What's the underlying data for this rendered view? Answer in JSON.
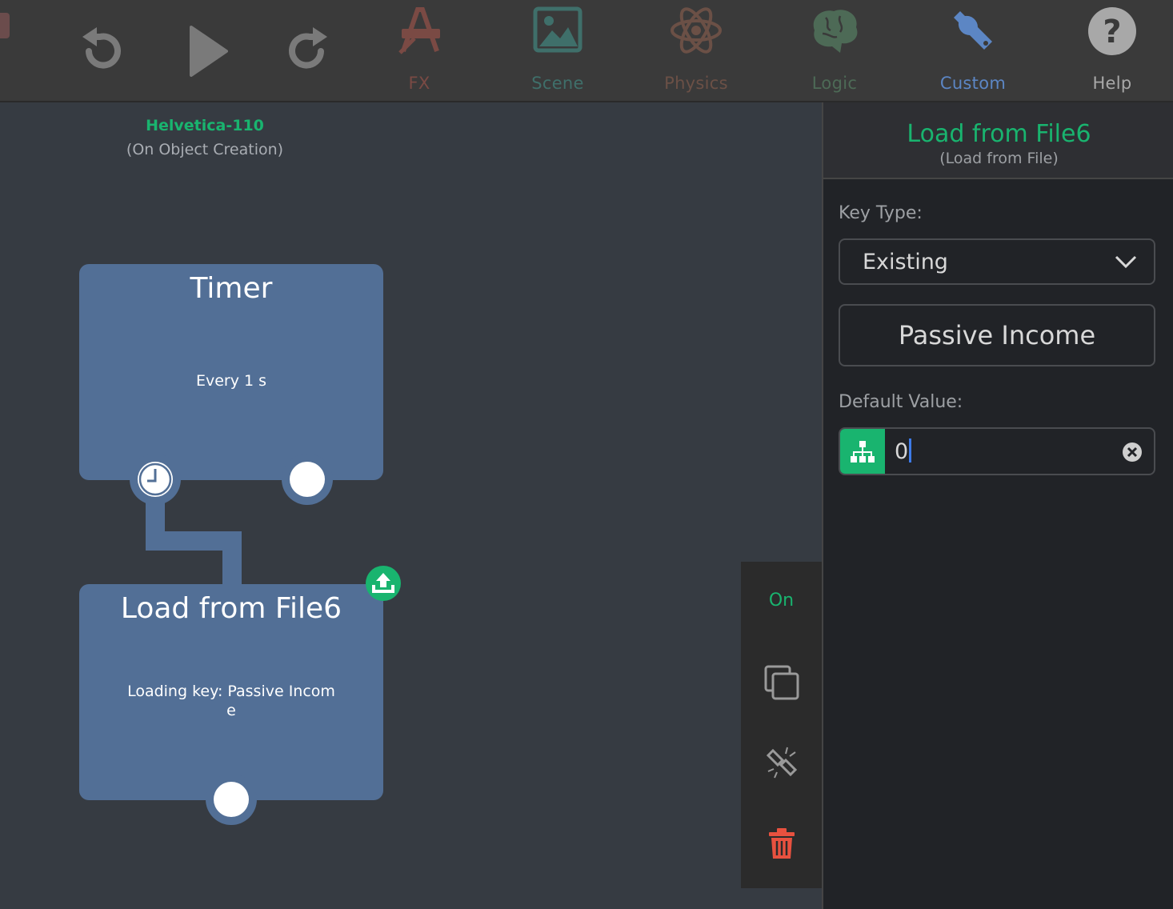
{
  "toolbar": {
    "undo_icon": "undo-icon",
    "play_icon": "play-icon",
    "redo_icon": "redo-icon",
    "tabs": [
      {
        "label": "FX",
        "icon": "fx-icon",
        "color": "#7a4a44"
      },
      {
        "label": "Scene",
        "icon": "scene-icon",
        "color": "#3f6f6a"
      },
      {
        "label": "Physics",
        "icon": "physics-icon",
        "color": "#6b5046"
      },
      {
        "label": "Logic",
        "icon": "brain-icon",
        "color": "#4d6a56"
      },
      {
        "label": "Custom",
        "icon": "wrench-icon",
        "color": "#5c86c4"
      },
      {
        "label": "Help",
        "icon": "help-icon",
        "color": "#a8a8a8"
      }
    ]
  },
  "canvas": {
    "object_name": "Helvetica-110",
    "event_name": "(On Object Creation)",
    "timer_node": {
      "title": "Timer",
      "body": "Every 1 s"
    },
    "load_node": {
      "title": "Load from File6",
      "body_line1": "Loading key: Passive Incom",
      "body_line2": "e"
    }
  },
  "mini_toolbar": {
    "toggle_label": "On"
  },
  "panel": {
    "title": "Load from File6",
    "subtitle": "(Load from File)",
    "key_type_label": "Key Type:",
    "key_type_value": "Existing",
    "key_name": "Passive Income",
    "default_value_label": "Default Value:",
    "default_value": "0"
  },
  "colors": {
    "accent": "#19b46f",
    "node": "#526f96",
    "delete": "#e8513f"
  }
}
